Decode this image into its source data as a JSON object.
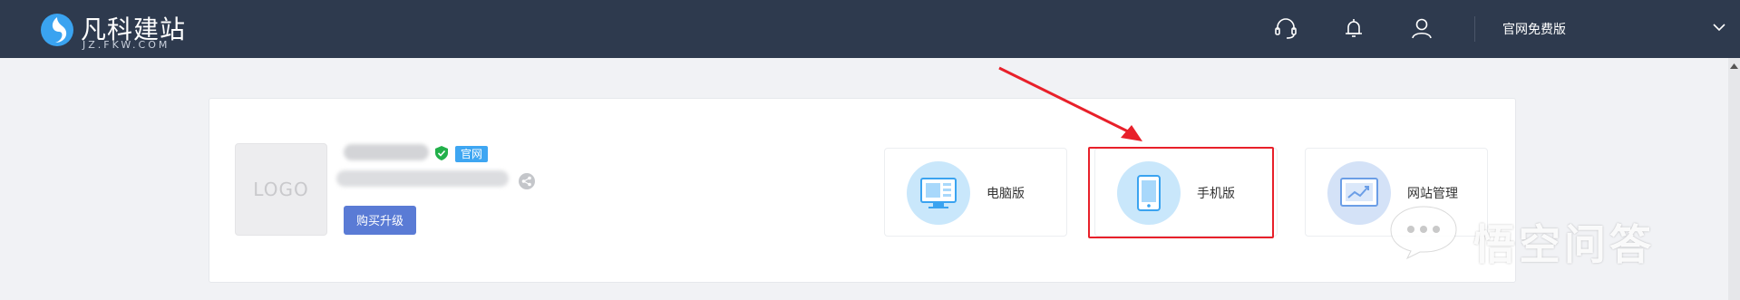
{
  "brand": {
    "name": "凡科建站",
    "domain": "JZ.FKW.COM"
  },
  "topbar": {
    "icons": [
      "headset-icon",
      "bell-icon",
      "user-icon"
    ],
    "edition": "官网免费版"
  },
  "site": {
    "logo_placeholder": "LOGO",
    "badge": "官网",
    "upgrade_label": "购买升级"
  },
  "tiles": [
    {
      "label": "电脑版",
      "icon": "desktop-icon"
    },
    {
      "label": "手机版",
      "icon": "mobile-icon"
    },
    {
      "label": "网站管理",
      "icon": "site-manage-icon"
    }
  ],
  "watermark": {
    "text": "悟空问答"
  },
  "colors": {
    "topbar_bg": "#2e3a4e",
    "page_bg": "#f1f2f5",
    "badge_blue": "#3ea6f2",
    "button_blue": "#5a7bd5",
    "highlight_red": "#e8202a"
  }
}
